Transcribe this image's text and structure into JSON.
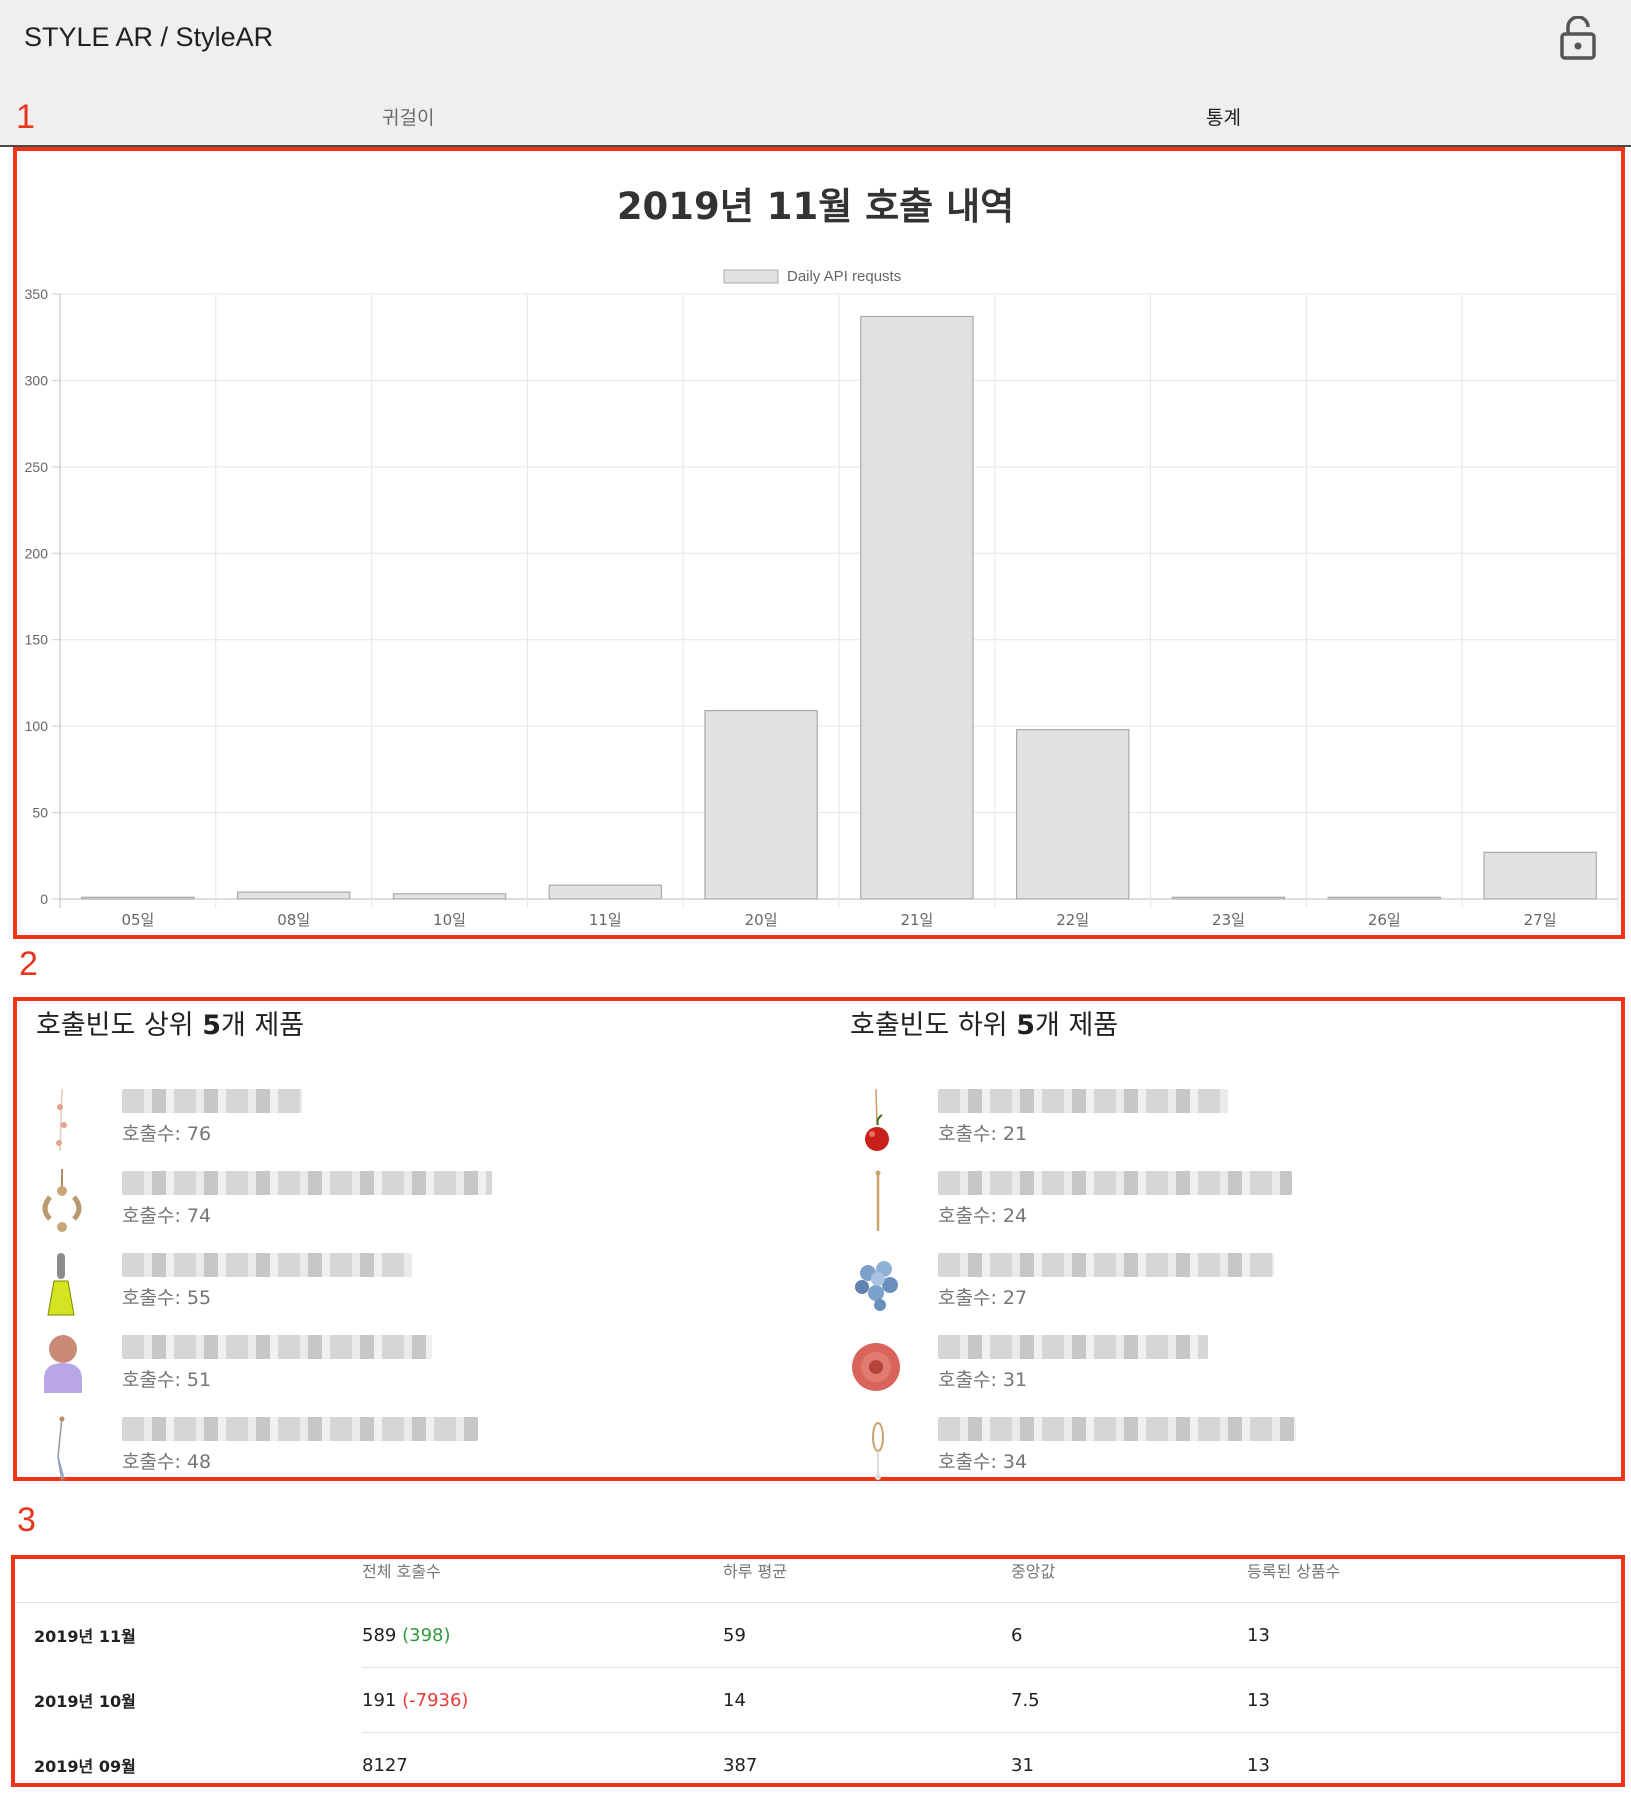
{
  "header": {
    "title": "STYLE AR / StyleAR",
    "lock_icon": "lock-open-icon"
  },
  "tabs": [
    {
      "label": "귀걸이"
    },
    {
      "label": "통계"
    }
  ],
  "markers": [
    "1",
    "2",
    "3"
  ],
  "chart_data": {
    "type": "bar",
    "title": "2019년 11월 호출 내역",
    "legend": "Daily API requsts",
    "legend_position": "top",
    "grid": true,
    "categories": [
      "05일",
      "08일",
      "10일",
      "11일",
      "20일",
      "21일",
      "22일",
      "23일",
      "26일",
      "27일"
    ],
    "values": [
      1,
      4,
      3,
      8,
      109,
      337,
      98,
      1,
      1,
      27
    ],
    "yticks": [
      "0",
      "50",
      "100",
      "150",
      "200",
      "250",
      "300",
      "350"
    ],
    "ylim": [
      0,
      350
    ],
    "bar_color": "#e2e2e2",
    "bar_border": "#a9a9a9"
  },
  "top5": {
    "title_a": "호출빈도 상위 ",
    "title_b": "5",
    "title_c": "개 제품",
    "items": [
      {
        "count": "호출수: 76",
        "icon": "dangle-earring"
      },
      {
        "count": "호출수: 74",
        "icon": "chanel-earring"
      },
      {
        "count": "호출수: 55",
        "icon": "yellow-drop-earring"
      },
      {
        "count": "호출수: 51",
        "icon": "lilac-ball-earring"
      },
      {
        "count": "호출수: 48",
        "icon": "thread-earring"
      }
    ]
  },
  "bottom5": {
    "title_a": "호출빈도 하위 ",
    "title_b": "5",
    "title_c": "개 제품",
    "items": [
      {
        "count": "호출수: 21",
        "icon": "cherry-earring"
      },
      {
        "count": "호출수: 24",
        "icon": "gold-bar-earring"
      },
      {
        "count": "호출수: 27",
        "icon": "blue-flower-earring"
      },
      {
        "count": "호출수: 31",
        "icon": "red-rose-earring"
      },
      {
        "count": "호출수: 34",
        "icon": "hoop-earring"
      }
    ]
  },
  "stats_table": {
    "headers": [
      "",
      "전체 호출수",
      "하루 평균",
      "중앙값",
      "등록된 상품수"
    ],
    "rows": [
      {
        "label": "2019년 11월",
        "total": "589",
        "delta": "(398)",
        "delta_dir": "up",
        "avg": "59",
        "median": "6",
        "items": "13"
      },
      {
        "label": "2019년 10월",
        "total": "191",
        "delta": "(-7936)",
        "delta_dir": "down",
        "avg": "14",
        "median": "7.5",
        "items": "13"
      },
      {
        "label": "2019년 09월",
        "total": "8127",
        "delta": "",
        "delta_dir": "",
        "avg": "387",
        "median": "31",
        "items": "13"
      }
    ]
  },
  "colors": {
    "accent_box": "#ee3317",
    "delta_up": "#2e9a3f",
    "delta_down": "#e53935"
  }
}
